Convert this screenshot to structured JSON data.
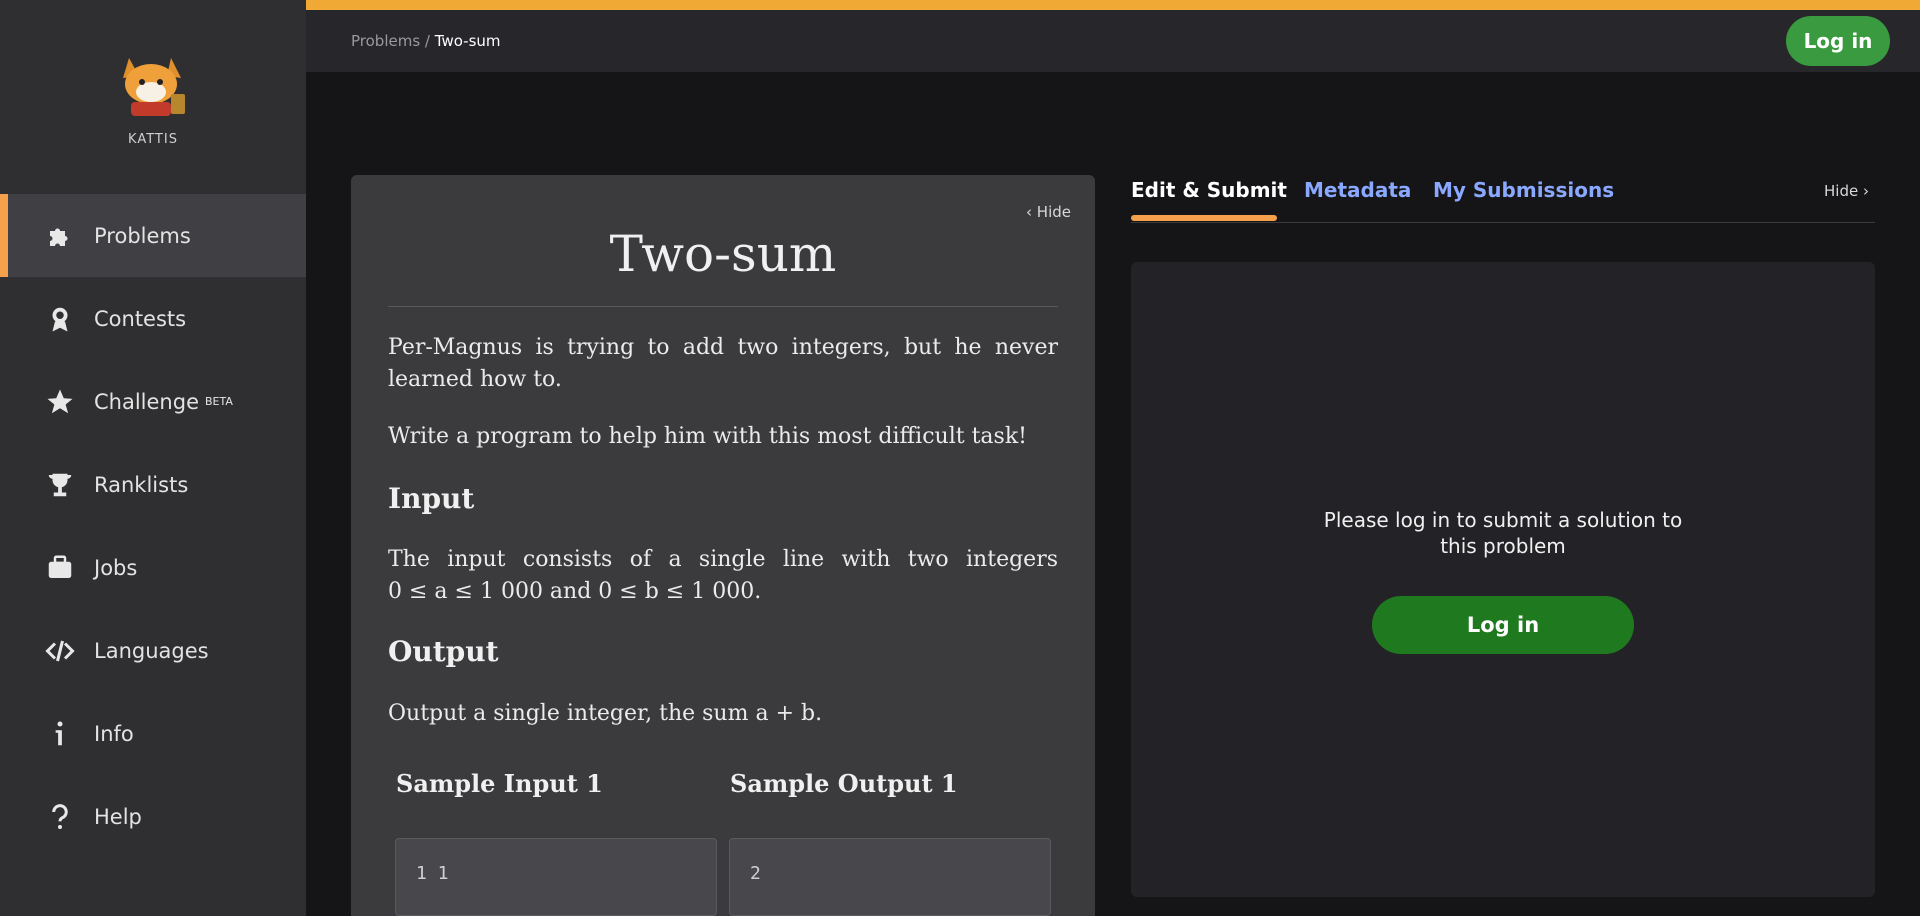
{
  "sidebar": {
    "logo_label": "KATTIS",
    "items": [
      {
        "label": "Problems",
        "icon": "puzzle-icon",
        "active": true
      },
      {
        "label": "Contests",
        "icon": "award-icon"
      },
      {
        "label": "Challenge",
        "icon": "star-icon",
        "badge": "BETA"
      },
      {
        "label": "Ranklists",
        "icon": "trophy-icon"
      },
      {
        "label": "Jobs",
        "icon": "briefcase-icon"
      },
      {
        "label": "Languages",
        "icon": "code-icon"
      },
      {
        "label": "Info",
        "icon": "info-icon"
      },
      {
        "label": "Help",
        "icon": "question-icon"
      }
    ]
  },
  "header": {
    "breadcrumb_root": "Problems",
    "breadcrumb_sep": "/",
    "breadcrumb_current": "Two-sum",
    "login_label": "Log in"
  },
  "problem": {
    "hide_label": "Hide",
    "title": "Two-sum",
    "intro_1": "Per-Magnus is trying to add two integers, but he never learned how to.",
    "intro_2": "Write a program to help him with this most difficult task!",
    "input_heading": "Input",
    "input_text_1": "The input consists of a single line with two integers",
    "input_text_2": "0 ≤ a ≤ 1 000 and 0 ≤ b ≤ 1 000.",
    "output_heading": "Output",
    "output_text": "Output a single integer, the sum a + b.",
    "sample_input_heading": "Sample Input 1",
    "sample_output_heading": "Sample Output 1",
    "sample_input": "1 1",
    "sample_output": "2"
  },
  "tabs": {
    "edit_submit": "Edit & Submit",
    "metadata": "Metadata",
    "my_submissions": "My Submissions",
    "hide_label": "Hide"
  },
  "submit": {
    "message_1": "Please log in to submit a solution to",
    "message_2": "this problem",
    "login_label": "Log in"
  },
  "colors": {
    "accent": "#f5a14b",
    "top_stripe": "#f0a935",
    "login_green": "#1f7a1f",
    "link_blue": "#8aa8ff"
  }
}
